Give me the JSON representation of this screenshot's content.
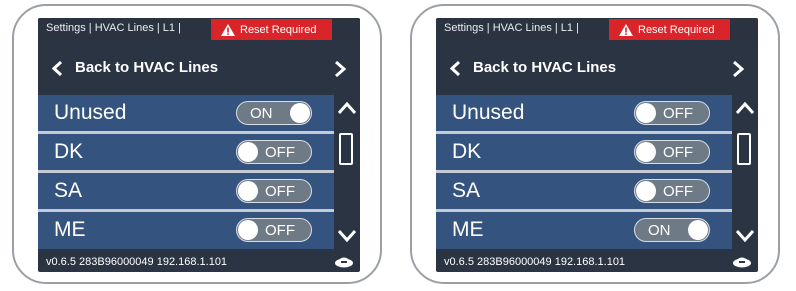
{
  "colors": {
    "screen_bg": "#2a3442",
    "row_bg": "#34547f",
    "reset_bg": "#d9252a",
    "toggle_bg": "#6f7a87"
  },
  "panels": [
    {
      "breadcrumb": "Settings | HVAC Lines | L1 |",
      "reset_label": "Reset Required",
      "back_label": "Back to HVAC Lines",
      "rows": [
        {
          "label": "Unused",
          "state": "ON"
        },
        {
          "label": "DK",
          "state": "OFF"
        },
        {
          "label": "SA",
          "state": "OFF"
        },
        {
          "label": "ME",
          "state": "OFF"
        }
      ],
      "footer": "v0.6.5  283B96000049  192.168.1.101",
      "icons": [
        "warning-icon",
        "chevron-left-icon",
        "chevron-right-icon",
        "scroll-up-icon",
        "scroll-down-icon",
        "logo-icon"
      ]
    },
    {
      "breadcrumb": "Settings | HVAC Lines | L1 |",
      "reset_label": "Reset Required",
      "back_label": "Back to HVAC Lines",
      "rows": [
        {
          "label": "Unused",
          "state": "OFF"
        },
        {
          "label": "DK",
          "state": "OFF"
        },
        {
          "label": "SA",
          "state": "OFF"
        },
        {
          "label": "ME",
          "state": "ON"
        }
      ],
      "footer": "v0.6.5  283B96000049  192.168.1.101",
      "icons": [
        "warning-icon",
        "chevron-left-icon",
        "chevron-right-icon",
        "scroll-up-icon",
        "scroll-down-icon",
        "logo-icon"
      ]
    }
  ]
}
